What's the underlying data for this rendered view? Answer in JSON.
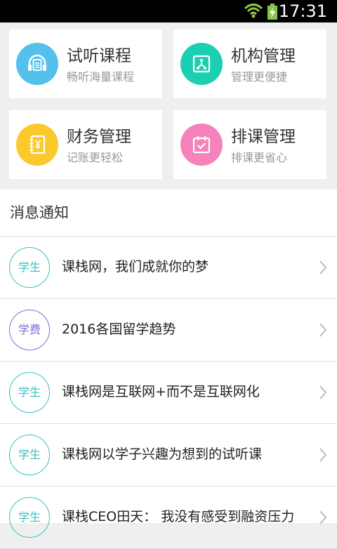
{
  "status_bar": {
    "time": "17:31"
  },
  "features": [
    {
      "title": "试听课程",
      "subtitle": "畅听海量课程",
      "icon": "headphones-icon",
      "color": "#54c0ec"
    },
    {
      "title": "机构管理",
      "subtitle": "管理更便捷",
      "icon": "org-tree-icon",
      "color": "#1ccfb1"
    },
    {
      "title": "财务管理",
      "subtitle": "记账更轻松",
      "icon": "yuan-notebook-icon",
      "color": "#fcc92c"
    },
    {
      "title": "排课管理",
      "subtitle": "排课更省心",
      "icon": "calendar-check-icon",
      "color": "#f582ba"
    }
  ],
  "notices": {
    "header": "消息通知",
    "items": [
      {
        "badge": "学生",
        "text": "课栈网，我们成就你的梦"
      },
      {
        "badge": "学费",
        "text": "2016各国留学趋势"
      },
      {
        "badge": "学生",
        "text": "课栈网是互联网+而不是互联网化"
      },
      {
        "badge": "学生",
        "text": "课栈网以学子兴趣为想到的试听课"
      },
      {
        "badge": "学生",
        "text": "课栈CEO田天： 我没有感受到融资压力"
      }
    ]
  },
  "colors": {
    "student_badge": "#38c0c4",
    "fee_badge": "#7b6fd6"
  }
}
